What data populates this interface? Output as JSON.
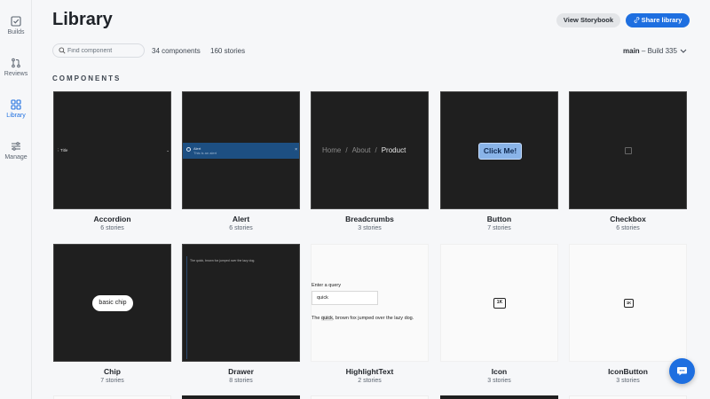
{
  "sidebar": {
    "items": [
      {
        "label": "Builds",
        "icon": "checkbox-icon",
        "active": false
      },
      {
        "label": "Reviews",
        "icon": "pull-request-icon",
        "active": false
      },
      {
        "label": "Library",
        "icon": "grid-icon",
        "active": true
      },
      {
        "label": "Manage",
        "icon": "sliders-icon",
        "active": false
      }
    ]
  },
  "header": {
    "title": "Library",
    "view_storybook": "View Storybook",
    "share_library": "Share library"
  },
  "toolbar": {
    "search_placeholder": "Find component",
    "components_count": "34 components",
    "stories_count": "160 stories",
    "branch": "main",
    "build": "Build 335"
  },
  "section_title": "COMPONENTS",
  "components": [
    {
      "name": "Accordion",
      "stories": "6 stories",
      "preview": {
        "title": "Title"
      }
    },
    {
      "name": "Alert",
      "stories": "6 stories",
      "preview": {
        "title": "Alert",
        "subtitle": "This is an alert"
      }
    },
    {
      "name": "Breadcrumbs",
      "stories": "3 stories",
      "preview": {
        "items": [
          "Home",
          "About",
          "Product"
        ]
      }
    },
    {
      "name": "Button",
      "stories": "7 stories",
      "preview": {
        "label": "Click Me!"
      }
    },
    {
      "name": "Checkbox",
      "stories": "6 stories"
    },
    {
      "name": "Chip",
      "stories": "7 stories",
      "preview": {
        "label": "basic chip"
      }
    },
    {
      "name": "Drawer",
      "stories": "8 stories",
      "preview": {
        "text": "The quick, brown fox jumped over the lazy dog."
      }
    },
    {
      "name": "HighlightText",
      "stories": "2 stories",
      "preview": {
        "label": "Enter a query",
        "value": "quick",
        "text_before": "The ",
        "highlight": "quick",
        "text_after": ", brown fox jumped over the lazy dog."
      }
    },
    {
      "name": "Icon",
      "stories": "3 stories",
      "preview": {
        "glyph": "1K"
      }
    },
    {
      "name": "IconButton",
      "stories": "3 stories",
      "preview": {
        "glyph": "1K"
      }
    }
  ],
  "colors": {
    "accent": "#1e6fe0",
    "preview_dark": "#1f1f1f"
  }
}
